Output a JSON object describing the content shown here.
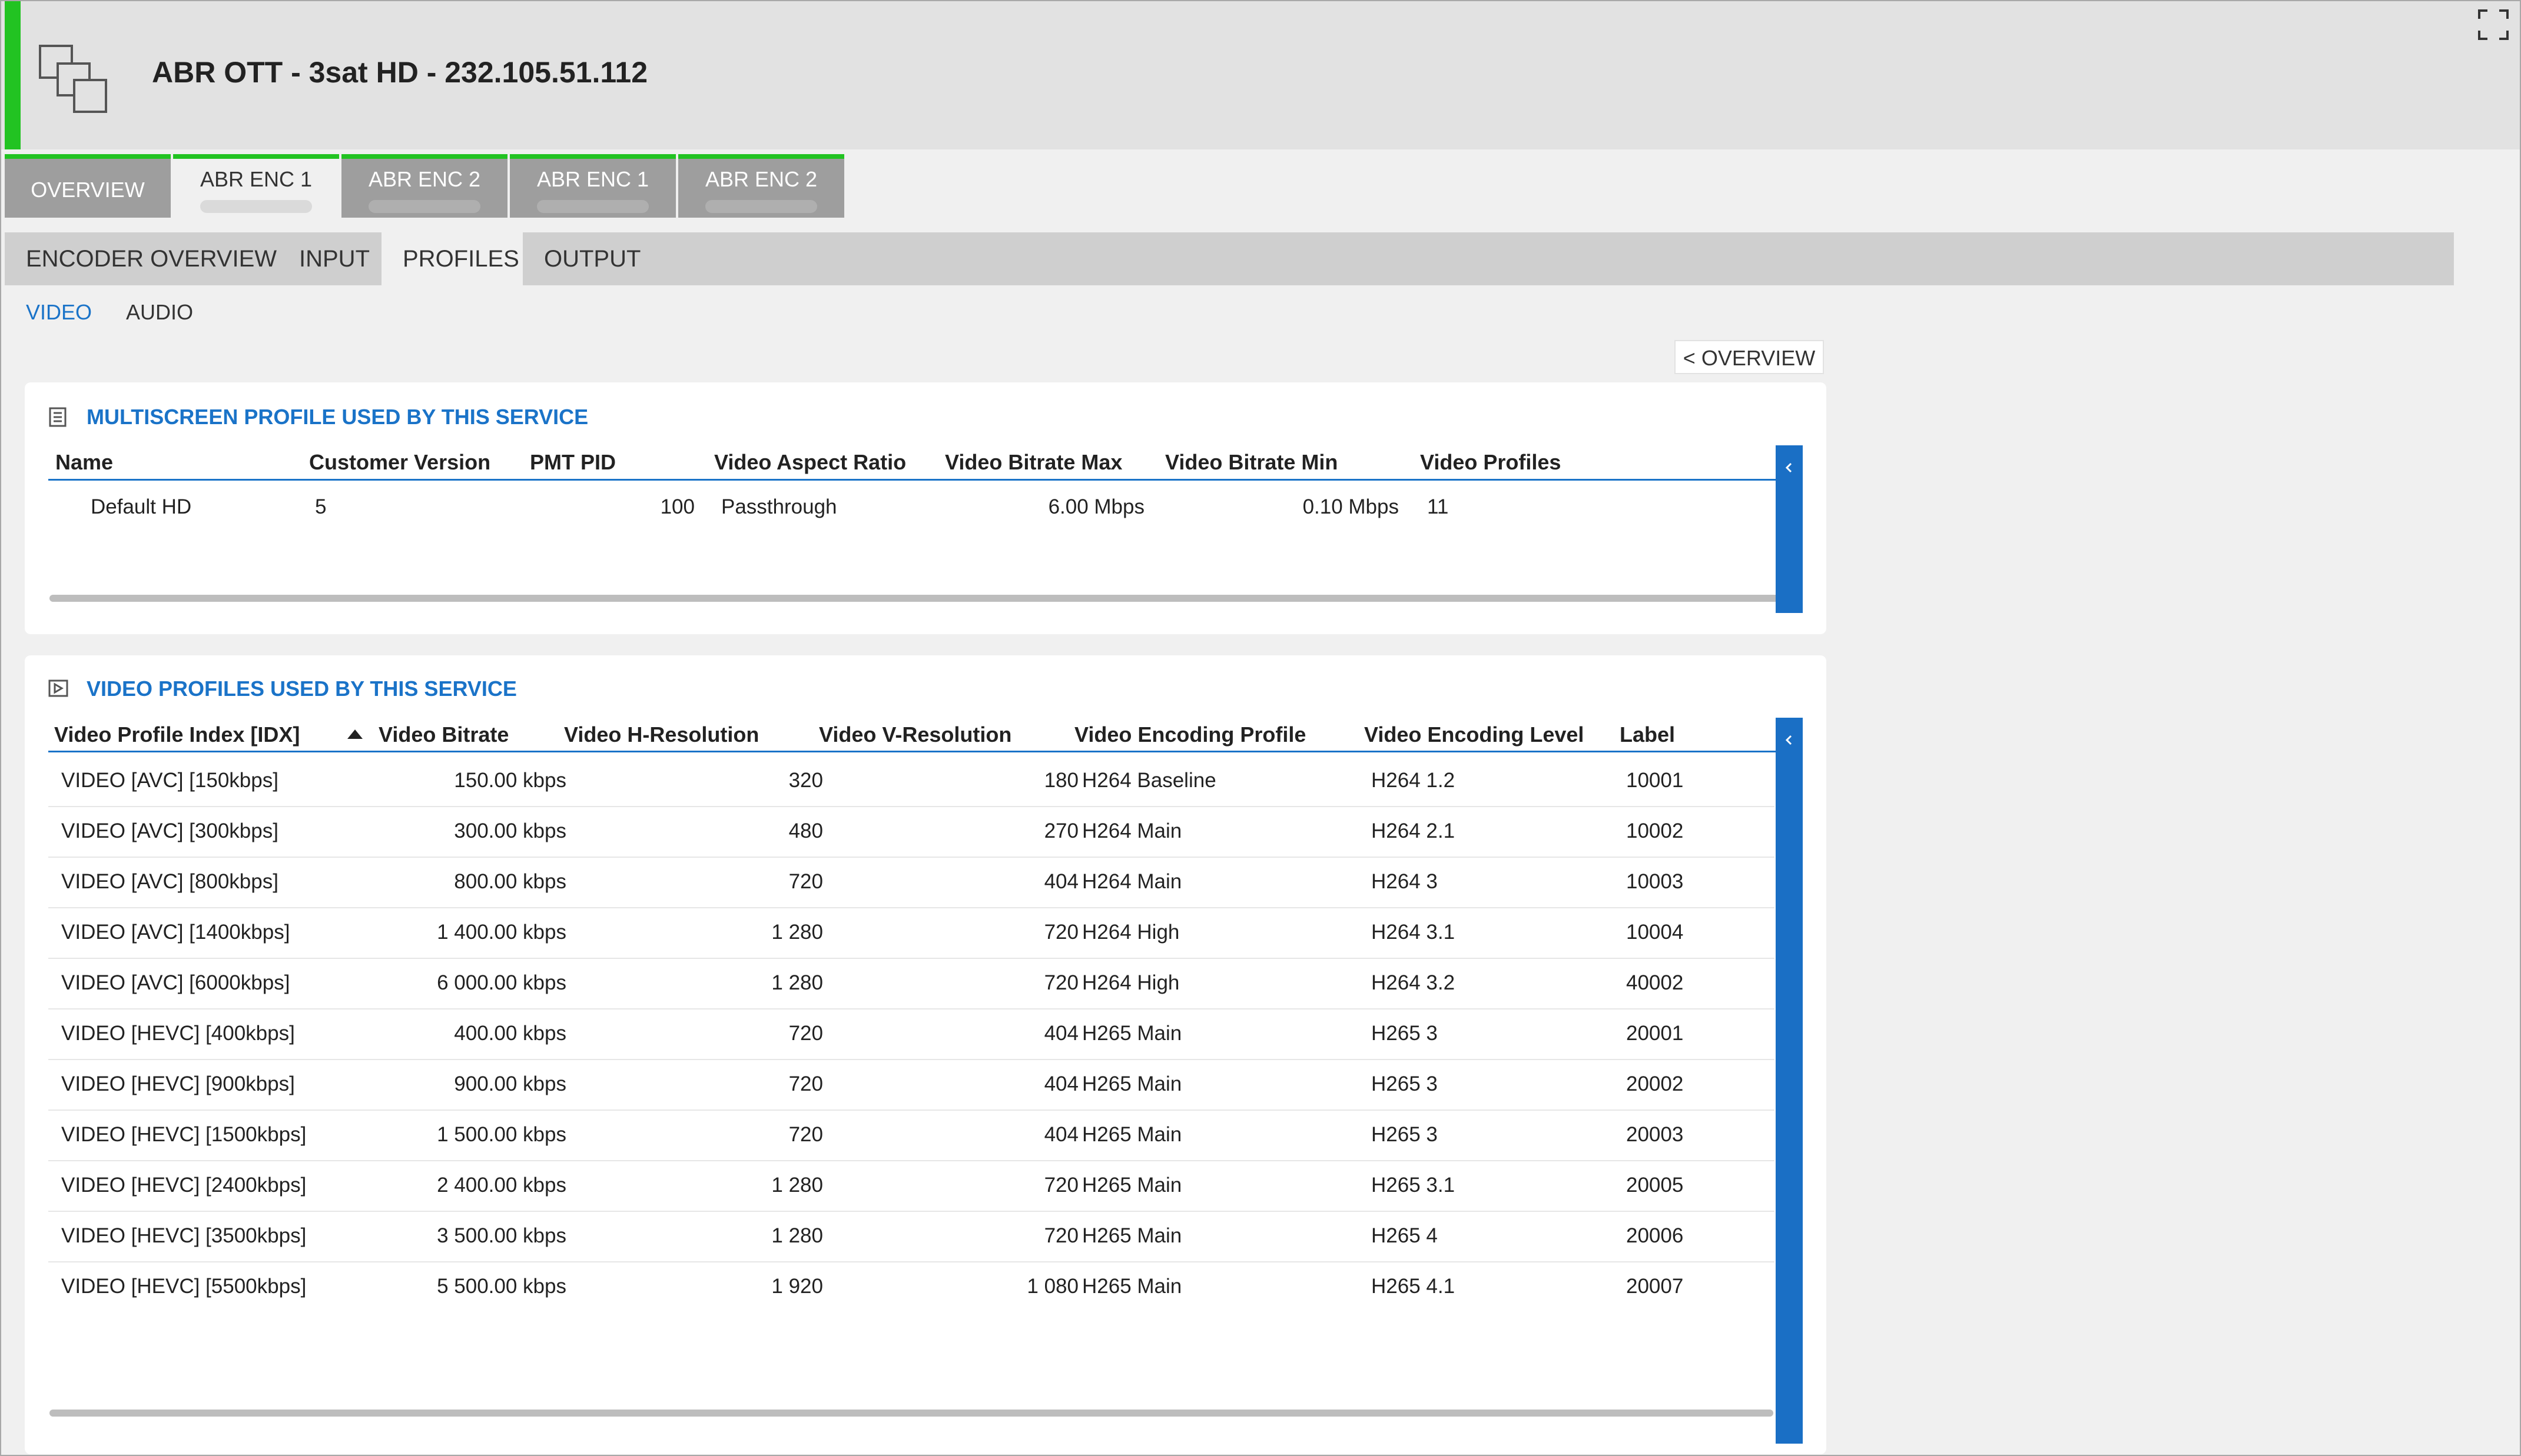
{
  "header": {
    "title": "ABR OTT - 3sat HD - 232.105.51.112",
    "accent_color": "#22c322"
  },
  "top_tabs": [
    {
      "label": "OVERVIEW"
    },
    {
      "label": "ABR ENC 1"
    },
    {
      "label": "ABR ENC 2"
    },
    {
      "label": "ABR ENC 1"
    },
    {
      "label": "ABR ENC 2"
    }
  ],
  "subnav": {
    "items": [
      "ENCODER OVERVIEW",
      "INPUT",
      "PROFILES",
      "OUTPUT"
    ],
    "active": "PROFILES"
  },
  "subsubnav": {
    "items": [
      "VIDEO",
      "AUDIO"
    ],
    "active": "VIDEO"
  },
  "overview_button": "< OVERVIEW",
  "multiscreen": {
    "title": "MULTISCREEN PROFILE USED BY THIS SERVICE",
    "columns": [
      "Name",
      "Customer Version",
      "PMT PID",
      "Video Aspect Ratio",
      "Video Bitrate Max",
      "Video Bitrate Min",
      "Video Profiles"
    ],
    "row": [
      "Default HD",
      "5",
      "100",
      "Passthrough",
      "6.00 Mbps",
      "0.10 Mbps",
      "11"
    ]
  },
  "video_profiles": {
    "title": "VIDEO PROFILES USED BY THIS SERVICE",
    "columns": [
      "Video Profile Index [IDX]",
      "Video Bitrate",
      "Video H-Resolution",
      "Video V-Resolution",
      "Video Encoding Profile",
      "Video Encoding Level",
      "Label"
    ],
    "rows": [
      [
        "VIDEO [AVC] [150kbps]",
        "150.00 kbps",
        "320",
        "180",
        "H264 Baseline",
        "H264 1.2",
        "10001"
      ],
      [
        "VIDEO [AVC] [300kbps]",
        "300.00 kbps",
        "480",
        "270",
        "H264 Main",
        "H264 2.1",
        "10002"
      ],
      [
        "VIDEO [AVC] [800kbps]",
        "800.00 kbps",
        "720",
        "404",
        "H264 Main",
        "H264 3",
        "10003"
      ],
      [
        "VIDEO [AVC] [1400kbps]",
        "1 400.00 kbps",
        "1 280",
        "720",
        "H264 High",
        "H264 3.1",
        "10004"
      ],
      [
        "VIDEO [AVC] [6000kbps]",
        "6 000.00 kbps",
        "1 280",
        "720",
        "H264 High",
        "H264 3.2",
        "40002"
      ],
      [
        "VIDEO [HEVC] [400kbps]",
        "400.00 kbps",
        "720",
        "404",
        "H265 Main",
        "H265 3",
        "20001"
      ],
      [
        "VIDEO [HEVC] [900kbps]",
        "900.00 kbps",
        "720",
        "404",
        "H265 Main",
        "H265 3",
        "20002"
      ],
      [
        "VIDEO [HEVC] [1500kbps]",
        "1 500.00 kbps",
        "720",
        "404",
        "H265 Main",
        "H265 3",
        "20003"
      ],
      [
        "VIDEO [HEVC] [2400kbps]",
        "2 400.00 kbps",
        "1 280",
        "720",
        "H265 Main",
        "H265 3.1",
        "20005"
      ],
      [
        "VIDEO [HEVC] [3500kbps]",
        "3 500.00 kbps",
        "1 280",
        "720",
        "H265 Main",
        "H265 4",
        "20006"
      ],
      [
        "VIDEO [HEVC] [5500kbps]",
        "5 500.00 kbps",
        "1 920",
        "1 080",
        "H265 Main",
        "H265 4.1",
        "20007"
      ]
    ]
  },
  "icons": {
    "app": "multiscreen-windows-icon",
    "fullscreen": "fullscreen-icon",
    "panel1": "list-icon",
    "panel2": "video-profile-icon",
    "collapse": "chevron-left-icon",
    "sort": "sort-ascending-icon"
  },
  "colors": {
    "link": "#1a73c8",
    "side_bar": "#1a6fc5"
  }
}
